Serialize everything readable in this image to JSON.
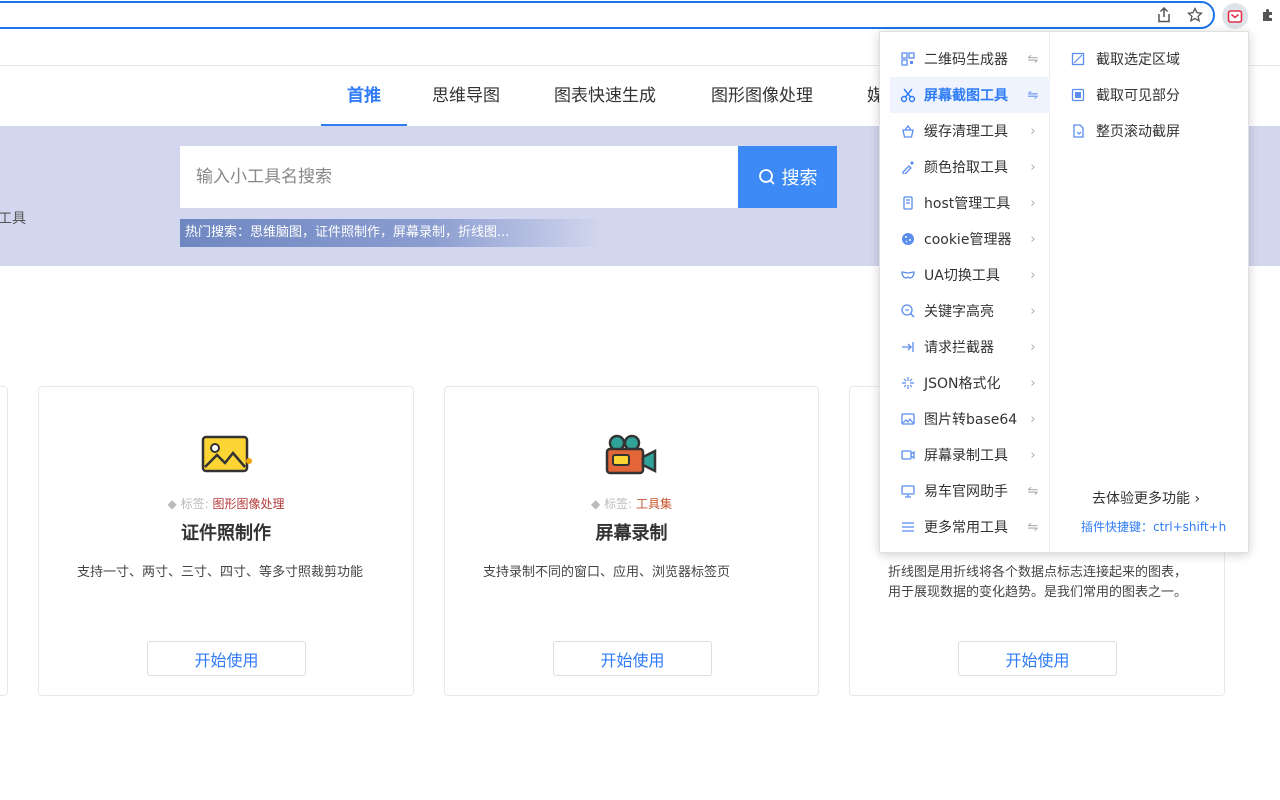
{
  "browser": {
    "share_icon": "share-icon",
    "star_icon": "bookmark-star-icon",
    "extension_icon": "extension-icon",
    "puzzle_icon": "puzzle-icon"
  },
  "nav": {
    "tabs": [
      {
        "label": "首推"
      },
      {
        "label": "思维导图"
      },
      {
        "label": "图表快速生成"
      },
      {
        "label": "图形图像处理"
      },
      {
        "label": "媒"
      }
    ]
  },
  "hero": {
    "left_text": "工具",
    "search_placeholder": "输入小工具名搜索",
    "search_button": "搜索",
    "hot_search": "热门搜索：思维脑图，证件照制作，屏幕录制，折线图..."
  },
  "cards": [
    {
      "icon": "image-icon",
      "tag_label": "标签:",
      "tag_value": "图形图像处理",
      "title": "证件照制作",
      "desc": "支持一寸、两寸、三寸、四寸、等多寸照裁剪功能",
      "button": "开始使用"
    },
    {
      "icon": "video-camera-icon",
      "tag_label": "标签:",
      "tag_value": "工具集",
      "title": "屏幕录制",
      "desc": "支持录制不同的窗口、应用、浏览器标签页",
      "button": "开始使用"
    },
    {
      "icon": "",
      "tag_label": "",
      "tag_value": "",
      "title": "",
      "desc": "折线图是用折线将各个数据点标志连接起来的图表，用于展现数据的变化趋势。是我们常用的图表之一。",
      "button": "开始使用"
    }
  ],
  "popup": {
    "menu": [
      {
        "label": "二维码生成器",
        "icon": "qrcode-icon",
        "arrow": "⇋"
      },
      {
        "label": "屏幕截图工具",
        "icon": "scissors-icon",
        "arrow": "⇋"
      },
      {
        "label": "缓存清理工具",
        "icon": "basket-icon",
        "arrow": "›"
      },
      {
        "label": "颜色拾取工具",
        "icon": "eyedropper-icon",
        "arrow": "›"
      },
      {
        "label": "host管理工具",
        "icon": "server-icon",
        "arrow": "›"
      },
      {
        "label": "cookie管理器",
        "icon": "cookie-icon",
        "arrow": "›"
      },
      {
        "label": "UA切换工具",
        "icon": "mask-icon",
        "arrow": "›"
      },
      {
        "label": "关键字高亮",
        "icon": "highlight-icon",
        "arrow": "›"
      },
      {
        "label": "请求拦截器",
        "icon": "intercept-icon",
        "arrow": "›"
      },
      {
        "label": "JSON格式化",
        "icon": "sparkle-icon",
        "arrow": "›"
      },
      {
        "label": "图片转base64",
        "icon": "picture-icon",
        "arrow": "›"
      },
      {
        "label": "屏幕录制工具",
        "icon": "record-icon",
        "arrow": "›"
      },
      {
        "label": "易车官网助手",
        "icon": "monitor-icon",
        "arrow": "⇋"
      },
      {
        "label": "更多常用工具",
        "icon": "menu-lines-icon",
        "arrow": "⇋"
      }
    ],
    "submenu": [
      {
        "label": "截取选定区域",
        "icon": "crop-icon"
      },
      {
        "label": "截取可见部分",
        "icon": "visible-capture-icon"
      },
      {
        "label": "整页滚动截屏",
        "icon": "page-scroll-icon"
      }
    ],
    "more_features": "去体验更多功能 ›",
    "shortcut": "插件快捷键：ctrl+shift+h"
  },
  "colors": {
    "accent": "#2f7cf6",
    "hero_bg": "#d2d6ee",
    "search_button": "#3d8af7",
    "tag_value": "#b23a3a"
  }
}
